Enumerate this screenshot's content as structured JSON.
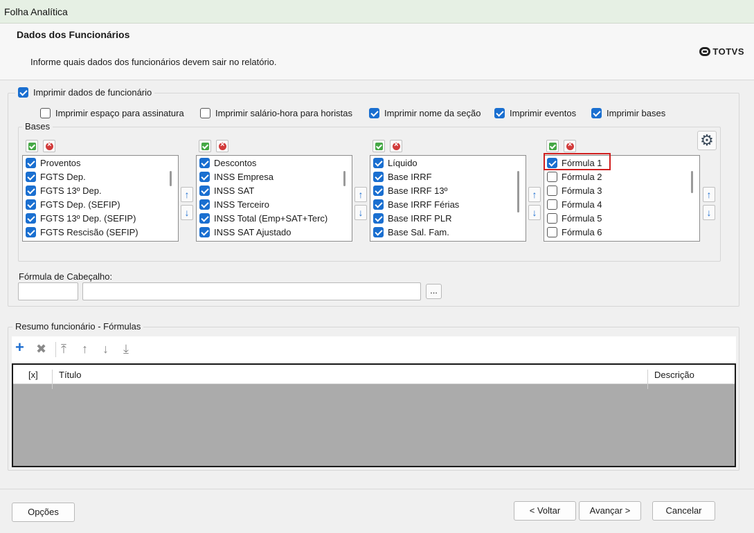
{
  "window": {
    "title": "Folha Analítica"
  },
  "header": {
    "title": "Dados dos Funcionários",
    "subtitle": "Informe quais dados dos funcionários devem sair no relatório.",
    "logo_text": "TOTVS"
  },
  "print_group": {
    "label": "Imprimir dados de funcionário",
    "checked": true,
    "options": [
      {
        "label": "Imprimir espaço para assinatura",
        "checked": false
      },
      {
        "label": "Imprimir salário-hora para horistas",
        "checked": false
      },
      {
        "label": "Imprimir nome da seção",
        "checked": true
      },
      {
        "label": "Imprimir eventos",
        "checked": true
      },
      {
        "label": "Imprimir bases",
        "checked": true
      }
    ]
  },
  "bases": {
    "label": "Bases",
    "lists": [
      {
        "items": [
          "Proventos",
          "FGTS Dep.",
          "FGTS 13º Dep.",
          "FGTS Dep. (SEFIP)",
          "FGTS 13º Dep. (SEFIP)",
          "FGTS Rescisão (SEFIP)"
        ],
        "checked": [
          true,
          true,
          true,
          true,
          true,
          true
        ]
      },
      {
        "items": [
          "Descontos",
          "INSS Empresa",
          "INSS SAT",
          "INSS Terceiro",
          "INSS Total (Emp+SAT+Terc)",
          "INSS SAT Ajustado"
        ],
        "checked": [
          true,
          true,
          true,
          true,
          true,
          true
        ]
      },
      {
        "items": [
          "Líquido",
          "Base IRRF",
          "Base IRRF 13º",
          "Base IRRF Férias",
          "Base IRRF PLR",
          "Base Sal. Fam."
        ],
        "checked": [
          true,
          true,
          true,
          true,
          true,
          true
        ]
      },
      {
        "items": [
          "Fórmula 1",
          "Fórmula 2",
          "Fórmula 3",
          "Fórmula 4",
          "Fórmula 5",
          "Fórmula 6"
        ],
        "checked": [
          true,
          false,
          false,
          false,
          false,
          false
        ]
      }
    ],
    "icons": {
      "select_all": "check-all-icon",
      "clear_all": "clear-all-icon",
      "up": "arrow-up-icon",
      "down": "arrow-down-icon",
      "settings": "gear-icon"
    }
  },
  "header_formula": {
    "label": "Fórmula de Cabeçalho:",
    "code_value": "",
    "description_value": "",
    "browse_label": "..."
  },
  "summary": {
    "label": "Resumo funcionário - Fórmulas",
    "toolbar_icons": [
      "add-icon",
      "delete-icon",
      "move-top-icon",
      "move-up-icon",
      "move-down-icon",
      "move-bottom-icon"
    ],
    "columns": [
      "[x]",
      "Título",
      "Descrição"
    ]
  },
  "footer": {
    "options": "Opções",
    "back": "< Voltar",
    "next": "Avançar >",
    "cancel": "Cancelar"
  },
  "colors": {
    "accent": "#1a6fd0",
    "highlight": "#d01f1f",
    "titlebar": "#e6f0e4"
  }
}
